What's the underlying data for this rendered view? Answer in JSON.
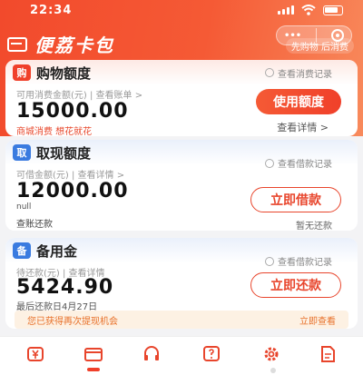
{
  "status_bar": {
    "time": "22:34"
  },
  "header": {
    "app_title": "便荔卡包",
    "slogan": "先购物 后消费",
    "capsule_more": "•••"
  },
  "shopping_card": {
    "title": "购物额度",
    "tag": "购",
    "top_link": "查看消费记录",
    "label": "可用消费金额(元) | 查看账单 >",
    "amount": "15000.00",
    "subtext": "商城消费 想花就花",
    "button": "使用额度",
    "details_link": "查看详情 >"
  },
  "cash_card": {
    "title": "取现额度",
    "tag": "取",
    "top_link": "查看借款记录",
    "label": "可借金额(元) | 查看详情 >",
    "amount": "12000.00",
    "null_text": "null",
    "repay_link": "查账还款",
    "button": "立即借款",
    "pause_text": "暂无还款"
  },
  "reserve_card": {
    "title": "备用金",
    "tag": "备",
    "top_link": "查看借款记录",
    "label": "待还款(元) | 查看详情",
    "amount": "5424.90",
    "due_text": "最后还款日4月27日",
    "button": "立即还款",
    "notice": "您已获得再次提现机会",
    "notice_action": "立即查看"
  },
  "tabbar": {
    "icons": [
      "yuan-icon",
      "card-icon",
      "headset-icon",
      "help-icon",
      "settings-icon",
      "document-icon"
    ]
  },
  "colors": {
    "brand": "#f24a2c",
    "accent": "#e8452c"
  }
}
